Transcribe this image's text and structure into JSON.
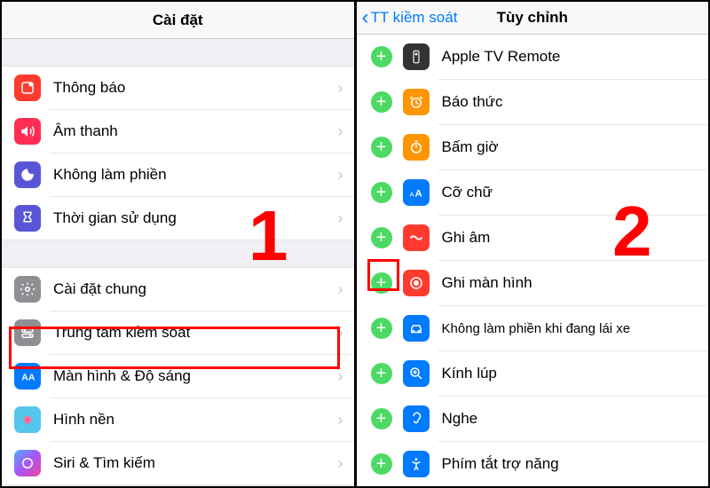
{
  "left": {
    "title": "Cài đặt",
    "group1": [
      {
        "label": "Thông báo",
        "icon": "notifications-icon",
        "bg": "#ff3b30"
      },
      {
        "label": "Âm thanh",
        "icon": "sound-icon",
        "bg": "#ff2d55"
      },
      {
        "label": "Không làm phiền",
        "icon": "dnd-icon",
        "bg": "#5856d6"
      },
      {
        "label": "Thời gian sử dụng",
        "icon": "screentime-icon",
        "bg": "#5856d6"
      }
    ],
    "group2": [
      {
        "label": "Cài đặt chung",
        "icon": "general-icon",
        "bg": "#8e8e93"
      },
      {
        "label": "Trung tâm kiềm soát",
        "icon": "control-center-icon",
        "bg": "#8e8e93"
      },
      {
        "label": "Màn hình & Độ sáng",
        "icon": "display-icon",
        "bg": "#007aff"
      },
      {
        "label": "Hình nền",
        "icon": "wallpaper-icon",
        "bg": "#54c7ec"
      },
      {
        "label": "Siri & Tìm kiếm",
        "icon": "siri-icon",
        "bg": "#000"
      }
    ]
  },
  "right": {
    "back": "TT kiềm soát",
    "title": "Tùy chỉnh",
    "items": [
      {
        "label": "Apple TV Remote",
        "icon": "remote-icon",
        "bg": "#333"
      },
      {
        "label": "Báo thức",
        "icon": "alarm-icon",
        "bg": "#ff9500"
      },
      {
        "label": "Bấm giờ",
        "icon": "timer-icon",
        "bg": "#ff9500"
      },
      {
        "label": "Cỡ chữ",
        "icon": "textsize-icon",
        "bg": "#007aff"
      },
      {
        "label": "Ghi âm",
        "icon": "voice-memo-icon",
        "bg": "#ff3b30"
      },
      {
        "label": "Ghi màn hình",
        "icon": "screen-record-icon",
        "bg": "#ff3b30"
      },
      {
        "label": "Không làm phiền khi đang lái xe",
        "icon": "driving-icon",
        "bg": "#007aff"
      },
      {
        "label": "Kính lúp",
        "icon": "magnifier-icon",
        "bg": "#007aff"
      },
      {
        "label": "Nghe",
        "icon": "hearing-icon",
        "bg": "#007aff"
      },
      {
        "label": "Phím tắt trợ năng",
        "icon": "accessibility-icon",
        "bg": "#007aff"
      }
    ]
  },
  "annotations": {
    "step1": "1",
    "step2": "2"
  }
}
